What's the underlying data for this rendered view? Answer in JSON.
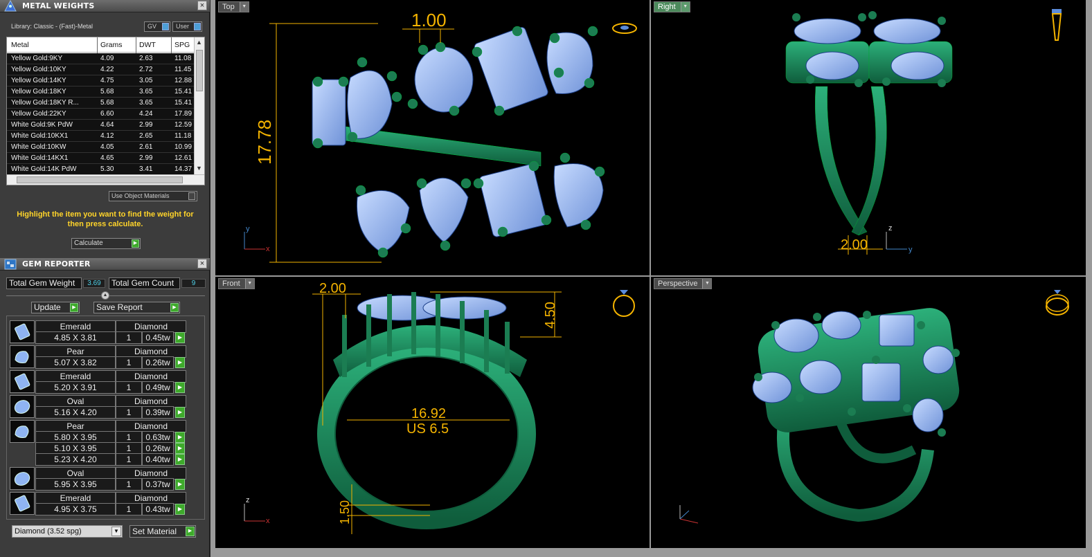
{
  "metal_weights": {
    "title": "METAL WEIGHTS",
    "library": "Library: Classic - (Fast)-Metal",
    "toggles": {
      "gv": "GV",
      "user": "User"
    },
    "columns": [
      "Metal",
      "Grams",
      "DWT",
      "SPG"
    ],
    "rows": [
      {
        "metal": "Yellow Gold:9KY",
        "grams": "4.09",
        "dwt": "2.63",
        "spg": "11.08"
      },
      {
        "metal": "Yellow Gold:10KY",
        "grams": "4.22",
        "dwt": "2.72",
        "spg": "11.45"
      },
      {
        "metal": "Yellow Gold:14KY",
        "grams": "4.75",
        "dwt": "3.05",
        "spg": "12.88"
      },
      {
        "metal": "Yellow Gold:18KY",
        "grams": "5.68",
        "dwt": "3.65",
        "spg": "15.41"
      },
      {
        "metal": "Yellow Gold:18KY R...",
        "grams": "5.68",
        "dwt": "3.65",
        "spg": "15.41"
      },
      {
        "metal": "Yellow Gold:22KY",
        "grams": "6.60",
        "dwt": "4.24",
        "spg": "17.89"
      },
      {
        "metal": "White Gold:9K PdW",
        "grams": "4.64",
        "dwt": "2.99",
        "spg": "12.59"
      },
      {
        "metal": "White Gold:10KX1",
        "grams": "4.12",
        "dwt": "2.65",
        "spg": "11.18"
      },
      {
        "metal": "White Gold:10KW",
        "grams": "4.05",
        "dwt": "2.61",
        "spg": "10.99"
      },
      {
        "metal": "White Gold:14KX1",
        "grams": "4.65",
        "dwt": "2.99",
        "spg": "12.61"
      },
      {
        "metal": "White Gold:14K PdW",
        "grams": "5.30",
        "dwt": "3.41",
        "spg": "14.37"
      }
    ],
    "use_object_materials": "Use Object Materials",
    "instructions": "Highlight the item you want to find the weight for then press calculate.",
    "calculate": "Calculate"
  },
  "gem_reporter": {
    "title": "GEM REPORTER",
    "total_weight_label": "Total Gem Weight",
    "total_weight_value": "3.69",
    "total_count_label": "Total Gem Count",
    "total_count_value": "9",
    "update": "Update",
    "save_report": "Save Report",
    "groups": [
      {
        "shape": "Emerald",
        "material": "Diamond",
        "icon": "emerald-cut-gem-icon",
        "items": [
          {
            "size": "4.85 X 3.81",
            "qty": "1",
            "tw": "0.45tw"
          }
        ]
      },
      {
        "shape": "Pear",
        "material": "Diamond",
        "icon": "pear-cut-gem-icon",
        "items": [
          {
            "size": "5.07 X 3.82",
            "qty": "1",
            "tw": "0.26tw"
          }
        ]
      },
      {
        "shape": "Emerald",
        "material": "Diamond",
        "icon": "emerald-cut-gem-icon",
        "items": [
          {
            "size": "5.20 X 3.91",
            "qty": "1",
            "tw": "0.49tw"
          }
        ]
      },
      {
        "shape": "Oval",
        "material": "Diamond",
        "icon": "oval-cut-gem-icon",
        "items": [
          {
            "size": "5.16 X 4.20",
            "qty": "1",
            "tw": "0.39tw"
          }
        ]
      },
      {
        "shape": "Pear",
        "material": "Diamond",
        "icon": "pear-cut-gem-icon",
        "items": [
          {
            "size": "5.80 X 3.95",
            "qty": "1",
            "tw": "0.63tw"
          },
          {
            "size": "5.10 X 3.95",
            "qty": "1",
            "tw": "0.26tw"
          },
          {
            "size": "5.23 X 4.20",
            "qty": "1",
            "tw": "0.40tw"
          }
        ]
      },
      {
        "shape": "Oval",
        "material": "Diamond",
        "icon": "oval-cut-gem-icon",
        "items": [
          {
            "size": "5.95 X 3.95",
            "qty": "1",
            "tw": "0.37tw"
          }
        ]
      },
      {
        "shape": "Emerald",
        "material": "Diamond",
        "icon": "emerald-cut-gem-icon",
        "items": [
          {
            "size": "4.95 X 3.75",
            "qty": "1",
            "tw": "0.43tw"
          }
        ]
      }
    ],
    "material_select": "Diamond    (3.52 spg)",
    "set_material": "Set Material"
  },
  "viewports": {
    "top": {
      "label": "Top",
      "dims": {
        "width_top": "1.00",
        "height_left": "17.78"
      },
      "axes": {
        "a": "y",
        "b": "x"
      }
    },
    "right": {
      "label": "Right",
      "dims": {
        "bottom": "2.00"
      },
      "axes": {
        "a": "z",
        "b": "y"
      }
    },
    "front": {
      "label": "Front",
      "dims": {
        "top_left": "2.00",
        "top_right": "4.50",
        "inner": "16.92",
        "size": "US 6.5",
        "bottom": "1.50"
      },
      "axes": {
        "a": "z",
        "b": "x"
      }
    },
    "perspective": {
      "label": "Perspective"
    }
  },
  "colors": {
    "metal": "#1f8a5c",
    "gem": "#8fb4f2",
    "dimension": "#f5b400",
    "active_label": "#4c8a5c"
  }
}
